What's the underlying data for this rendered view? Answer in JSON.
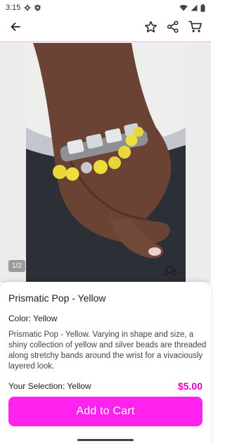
{
  "status_bar": {
    "time": "3:15"
  },
  "app_bar": {
    "back_icon": "arrow-left-icon",
    "actions": [
      "star-icon",
      "share-icon",
      "cart-icon"
    ]
  },
  "gallery": {
    "page_indicator": "1/2"
  },
  "product": {
    "title": "Prismatic Pop - Yellow",
    "color_label": "Color: Yellow",
    "description": "Prismatic Pop - Yellow. Varying in shape and size, a shiny collection of yellow and silver beads are threaded along stretchy bands around the wrist for a vivaciously layered look.",
    "selection_label": "Your Selection: Yellow",
    "price": "$5.00"
  },
  "cart_button": {
    "label": "Add to Cart"
  },
  "colors": {
    "accent": "#ff22ee",
    "price": "#e000c4",
    "divider": "#f2a0e6"
  }
}
